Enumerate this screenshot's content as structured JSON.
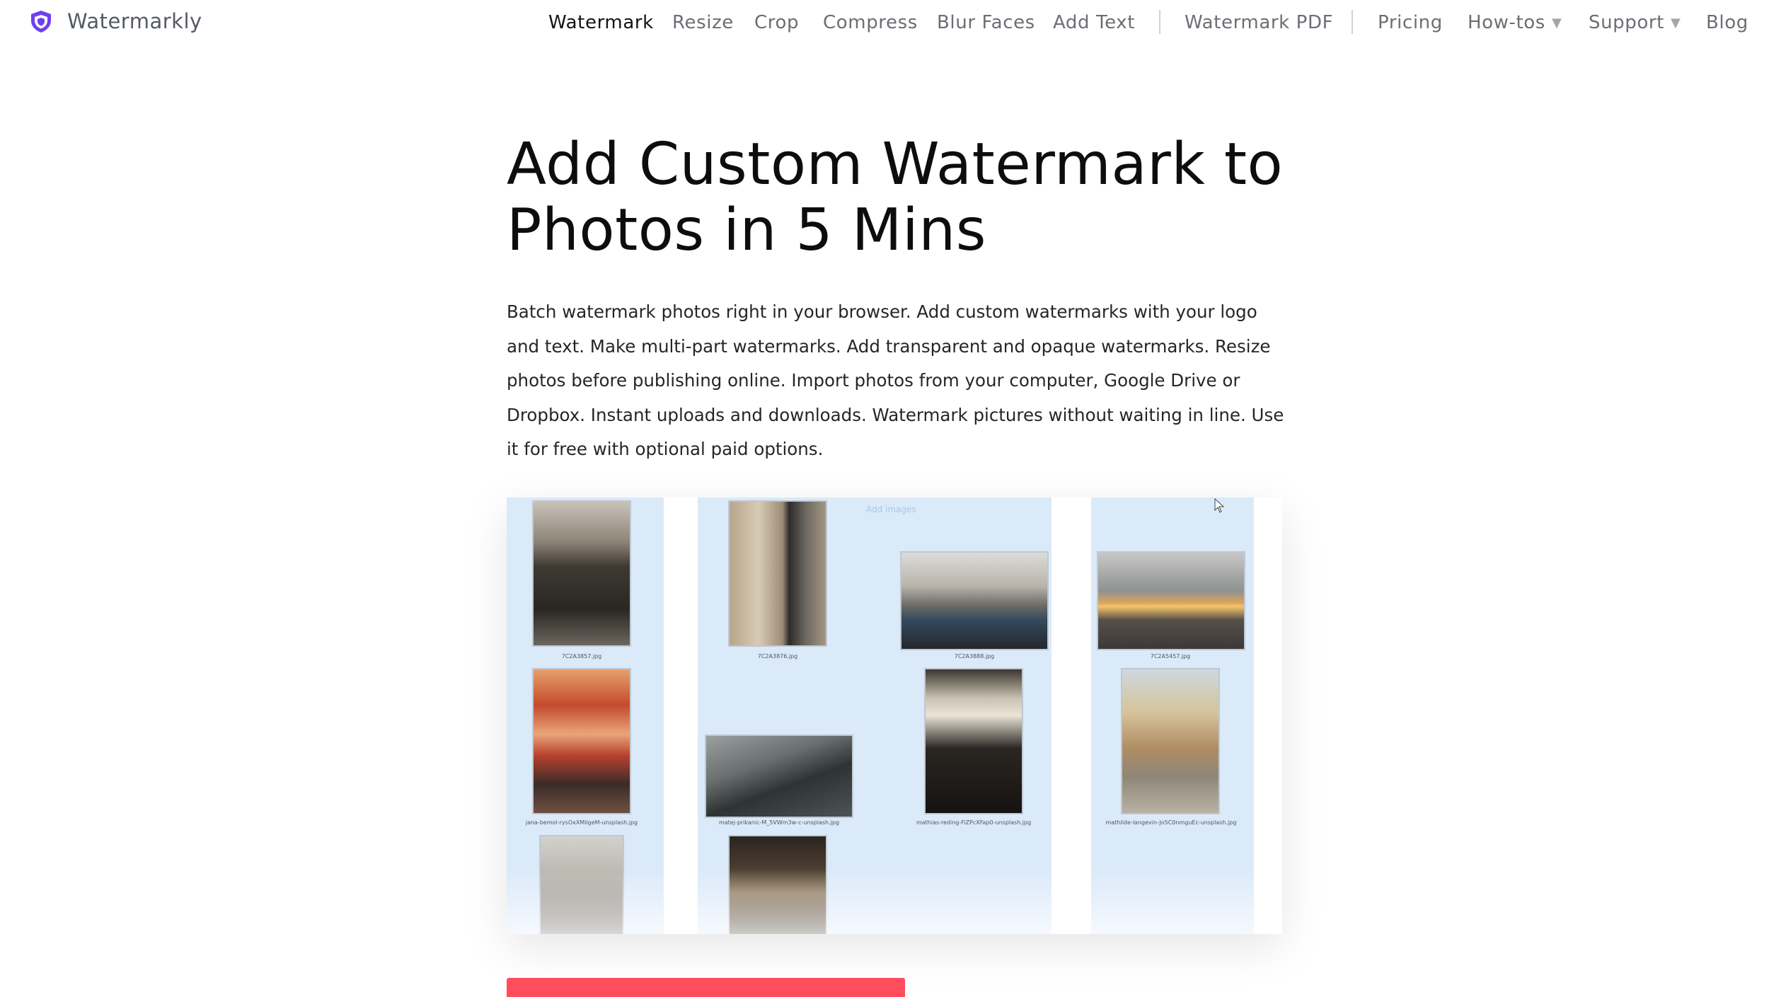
{
  "brand": {
    "name": "Watermarkly",
    "logo_icon": "shield-icon",
    "logo_color": "#6d3ff0"
  },
  "nav": {
    "items": [
      {
        "label": "Watermark",
        "active": true
      },
      {
        "label": "Resize"
      },
      {
        "label": "Crop"
      },
      {
        "label": "Compress"
      },
      {
        "label": "Blur Faces"
      },
      {
        "label": "Add Text"
      },
      {
        "label": "Watermark PDF"
      },
      {
        "label": "Pricing"
      },
      {
        "label": "How-tos",
        "dropdown": true
      },
      {
        "label": "Support",
        "dropdown": true
      },
      {
        "label": "Blog"
      }
    ],
    "dropdown_icon": "caret-down-icon"
  },
  "hero": {
    "title_line1": "Add Custom Watermark to",
    "title_line2": "Photos in 5 Mins",
    "description": "Batch watermark photos right in your browser. Add custom watermarks with your logo and text. Make multi-part watermarks. Add transparent and opaque watermarks. Resize photos before publishing online. Import photos from your computer, Google Drive or Dropbox. Instant uploads and downloads. Watermark pictures without waiting in line. Use it for free with optional paid options."
  },
  "preview": {
    "ghost_label": "Add images",
    "files": [
      "7C2A3857.jpg",
      "7C2A3876.jpg",
      "7C2A3888.jpg",
      "7C2A5457.jpg",
      "jana-bemol-rysOxXMilgeM-unsplash.jpg",
      "matej-prikanic-M_5VWm3w-c-unsplash.jpg",
      "mathias-reding-FiZPcXFap0-unsplash.jpg",
      "mathilde-langevin-Jo5C0nmguEc-unsplash.jpg"
    ],
    "column_color": "#dbeaf9"
  },
  "cta": {
    "color": "#ff4d5d"
  }
}
